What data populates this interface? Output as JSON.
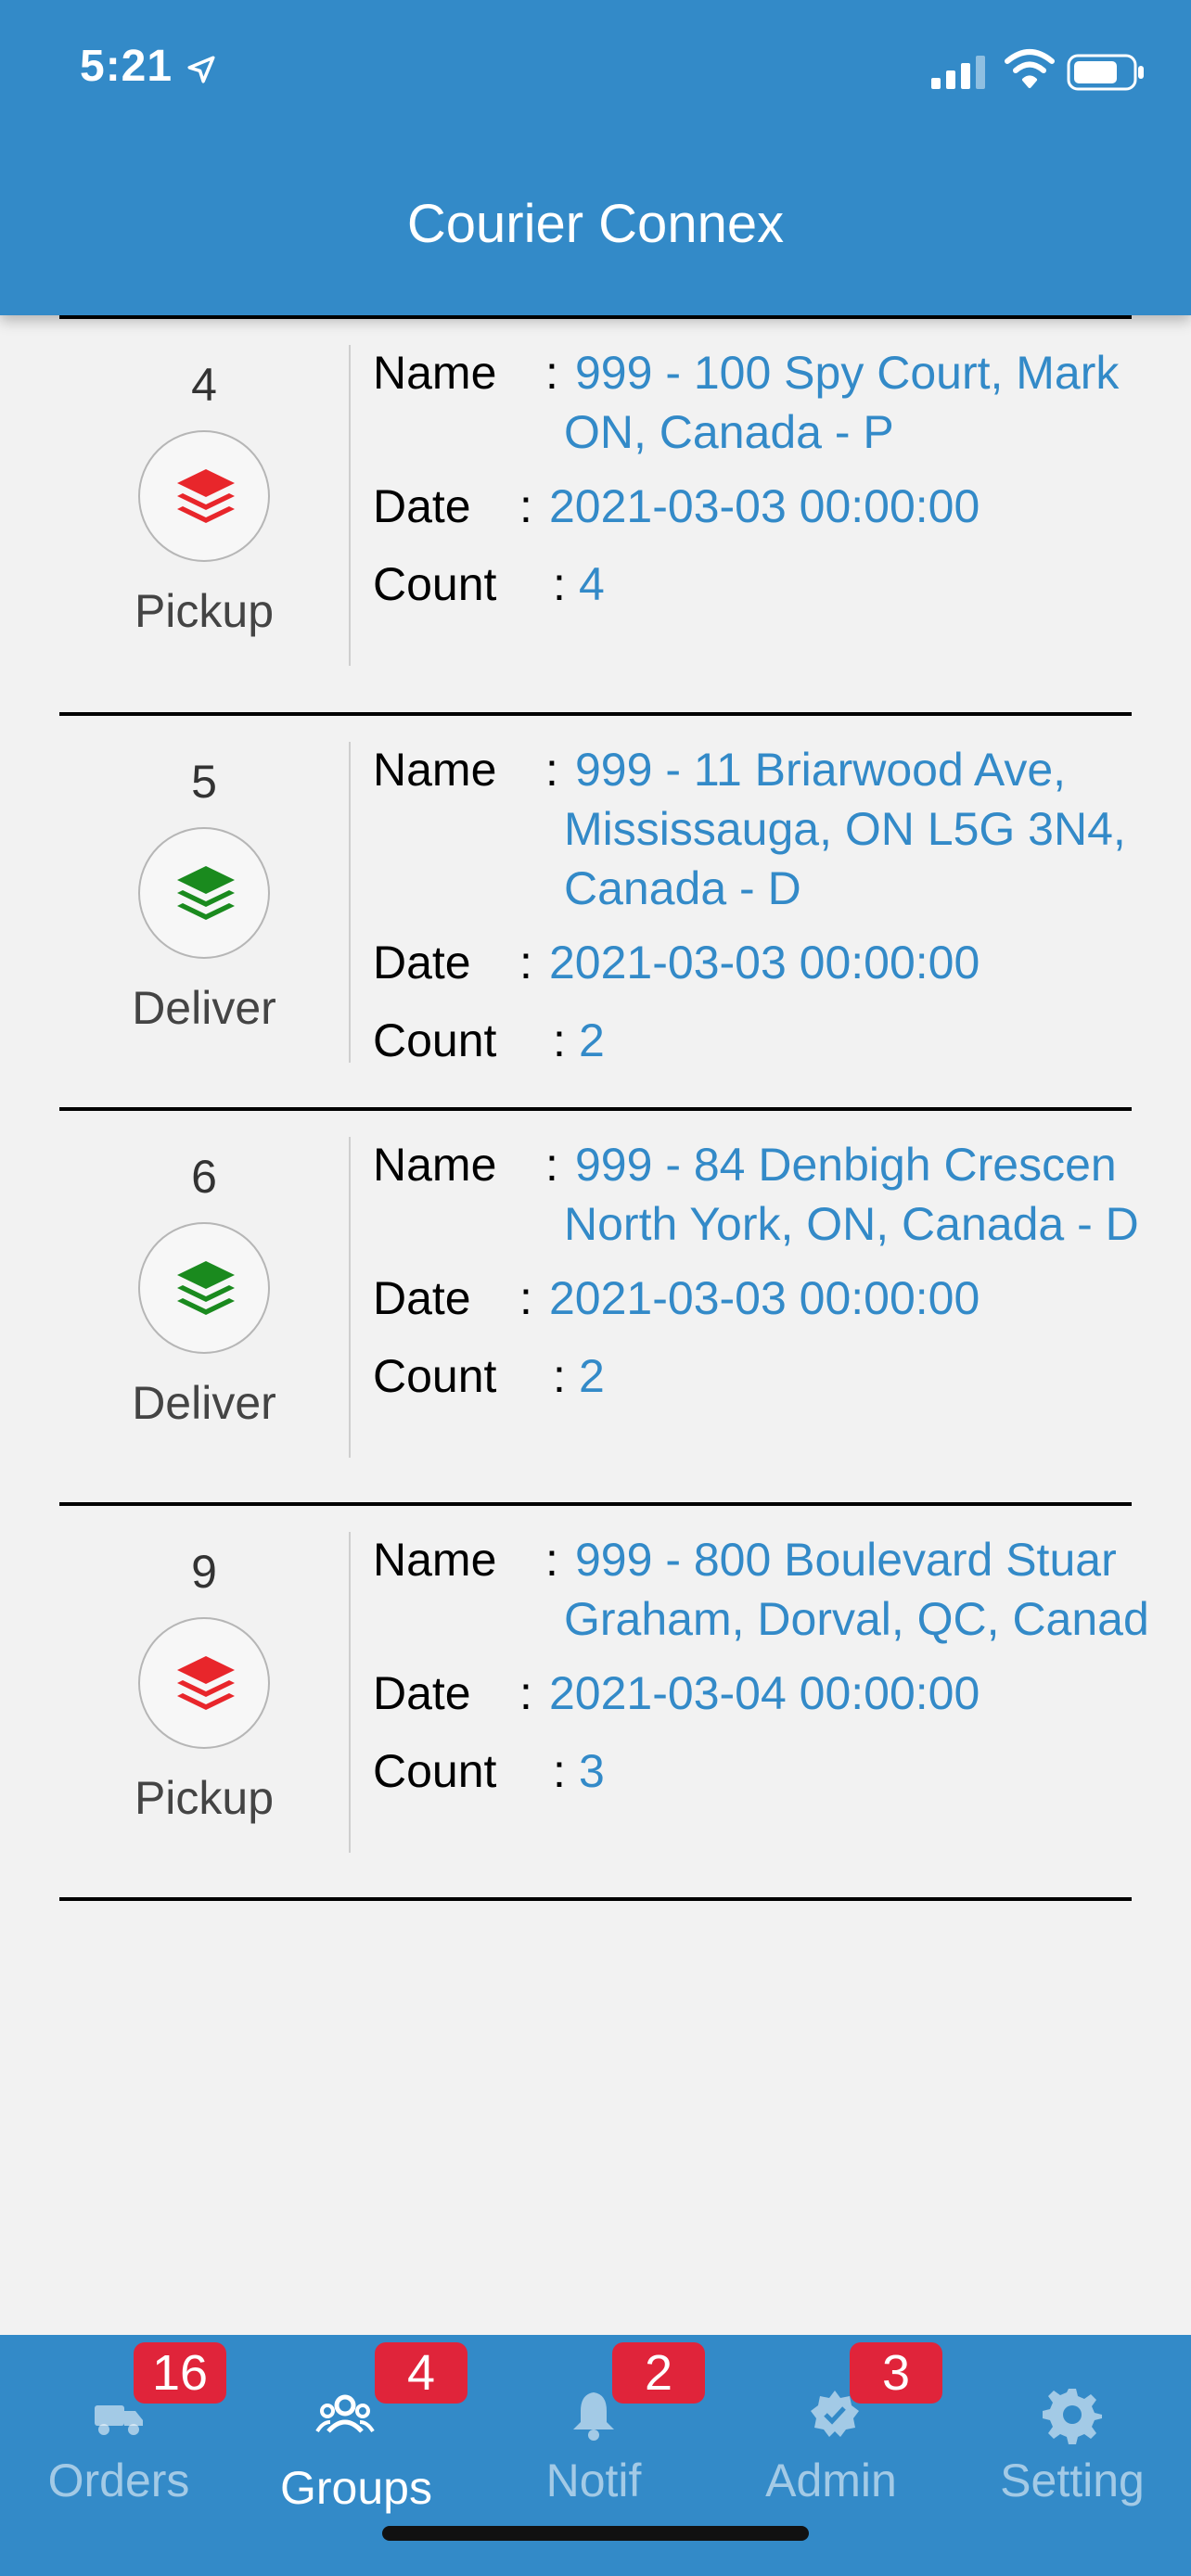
{
  "status_bar": {
    "time": "5:21"
  },
  "header": {
    "title": "Courier Connex"
  },
  "labels": {
    "name": "Name",
    "date": "Date",
    "count": "Count",
    "colon": ":"
  },
  "colors": {
    "primary": "#338ac8",
    "pickup": "#e8262b",
    "deliver": "#1a8a1e",
    "badge": "#e0243a"
  },
  "groups": [
    {
      "number": "4",
      "type": "Pickup",
      "icon": "stack-icon-red",
      "name_lines": [
        "999 - 100 Spy Court, Mark",
        "ON, Canada - P"
      ],
      "date": "2021-03-03 00:00:00",
      "count": "4"
    },
    {
      "number": "5",
      "type": "Deliver",
      "icon": "stack-icon-green",
      "name_lines": [
        "999 - 11 Briarwood Ave,",
        "Mississauga, ON L5G 3N4,",
        "Canada - D"
      ],
      "date": "2021-03-03 00:00:00",
      "count": "2"
    },
    {
      "number": "6",
      "type": "Deliver",
      "icon": "stack-icon-green",
      "name_lines": [
        "999 - 84 Denbigh Crescen",
        "North York, ON, Canada - D"
      ],
      "date": "2021-03-03 00:00:00",
      "count": "2"
    },
    {
      "number": "9",
      "type": "Pickup",
      "icon": "stack-icon-red",
      "name_lines": [
        "999 - 800 Boulevard Stuar",
        "Graham, Dorval, QC, Canad"
      ],
      "date": "2021-03-04 00:00:00",
      "count": "3"
    }
  ],
  "tabs": [
    {
      "label": "Orders",
      "badge": "16",
      "icon": "truck-icon",
      "active": false
    },
    {
      "label": "Groups",
      "badge": "4",
      "icon": "group-icon",
      "active": true
    },
    {
      "label": "Notif",
      "badge": "2",
      "icon": "bell-icon",
      "active": false
    },
    {
      "label": "Admin",
      "badge": "3",
      "icon": "badge-check-icon",
      "active": false
    },
    {
      "label": "Setting",
      "badge": "",
      "icon": "gear-icon",
      "active": false
    }
  ]
}
